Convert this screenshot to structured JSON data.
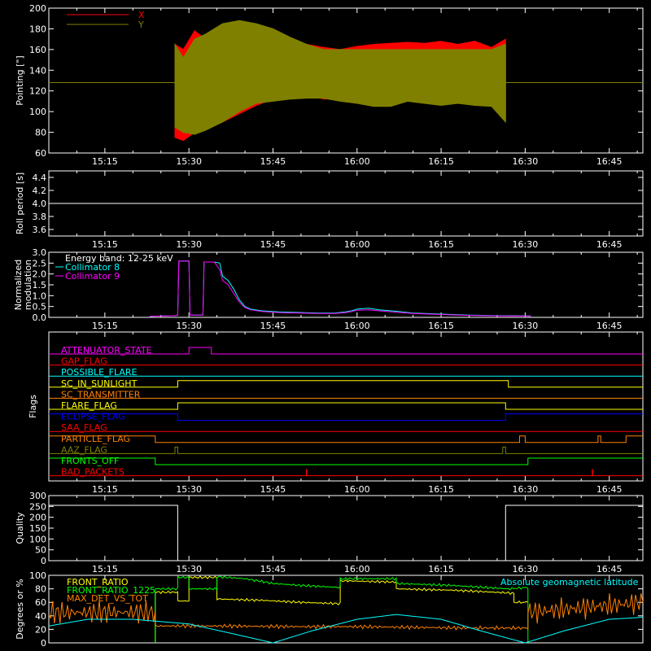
{
  "time_ticks": [
    "15:15",
    "15:30",
    "15:45",
    "16:00",
    "16:15",
    "16:30",
    "16:45"
  ],
  "time_range_min": [
    905,
    1011
  ],
  "tick_minutes": [
    915,
    930,
    945,
    960,
    975,
    990,
    1005
  ],
  "colors": {
    "red": "#ff0000",
    "olive": "#808000",
    "white": "#ffffff",
    "cyan": "#00ffff",
    "magenta": "#ff00ff",
    "yellow": "#ffff00",
    "orange": "#ff8000",
    "green": "#00ff00",
    "blue": "#0000ff"
  },
  "chart_data": [
    {
      "type": "area",
      "panel": "pointing",
      "ylabel": "Pointing [\"]",
      "ylim": [
        60,
        200
      ],
      "yticks": [
        60,
        80,
        100,
        120,
        140,
        160,
        180,
        200
      ],
      "legend": [
        "X",
        "Y"
      ],
      "baseline": 128,
      "series": [
        {
          "name": "X",
          "color": "#ff0000",
          "x": [
            927.5,
            929,
            931,
            933,
            936,
            939,
            942,
            945,
            948,
            951,
            954,
            957,
            960,
            963,
            966,
            969,
            972,
            975,
            978,
            981,
            984,
            986.5
          ],
          "max": [
            165,
            160,
            178,
            170,
            182,
            176,
            178,
            175,
            170,
            165,
            162,
            160,
            163,
            165,
            166,
            167,
            166,
            168,
            165,
            168,
            162,
            170
          ],
          "min": [
            75,
            72,
            80,
            84,
            90,
            98,
            106,
            112,
            115,
            118,
            112,
            113,
            115,
            112,
            115,
            112,
            115,
            110,
            115,
            110,
            112,
            95
          ]
        },
        {
          "name": "Y",
          "color": "#808000",
          "x": [
            927.5,
            929,
            931,
            933,
            936,
            939,
            942,
            945,
            948,
            951,
            954,
            957,
            960,
            963,
            966,
            969,
            972,
            975,
            978,
            981,
            984,
            986.5
          ],
          "max": [
            165,
            152,
            170,
            175,
            185,
            188,
            185,
            180,
            172,
            165,
            160,
            160,
            160,
            160,
            160,
            160,
            160,
            160,
            160,
            160,
            160,
            165
          ],
          "min": [
            85,
            80,
            78,
            82,
            90,
            100,
            108,
            110,
            112,
            113,
            113,
            110,
            108,
            105,
            105,
            110,
            108,
            106,
            108,
            106,
            105,
            90
          ]
        }
      ]
    },
    {
      "type": "line",
      "panel": "roll",
      "ylabel": "Roll period [s]",
      "ylim": [
        3.5,
        4.5
      ],
      "yticks": [
        3.6,
        3.8,
        4.0,
        4.2,
        4.4
      ],
      "series": [
        {
          "name": "",
          "color": "#ffffff",
          "x": [
            905,
            1011
          ],
          "y": [
            4.0,
            4.0
          ]
        }
      ]
    },
    {
      "type": "line",
      "panel": "modulation",
      "ylabel": "Normalized modulation",
      "ylim": [
        0,
        3.0
      ],
      "yticks": [
        0.0,
        0.5,
        1.0,
        1.5,
        2.0,
        2.5,
        3.0
      ],
      "annotation": "Energy band: 12-25 keV",
      "legend": [
        "Collimator 8",
        "Collimator 9"
      ],
      "series": [
        {
          "name": "Collimator 8",
          "color": "#00ffff",
          "x": [
            923,
            927.5,
            928,
            928.2,
            930,
            930.2,
            932.5,
            932.7,
            934.5,
            935.5,
            936,
            937,
            938,
            939,
            940,
            941,
            943,
            946,
            950,
            953,
            956,
            958,
            959,
            960,
            962,
            964,
            967,
            970,
            975,
            980,
            985,
            990,
            991
          ],
          "y": [
            0.05,
            0.08,
            0.1,
            2.6,
            2.6,
            0.1,
            0.1,
            2.55,
            2.55,
            2.5,
            1.9,
            1.7,
            1.3,
            0.8,
            0.5,
            0.38,
            0.3,
            0.25,
            0.22,
            0.2,
            0.2,
            0.25,
            0.3,
            0.38,
            0.42,
            0.35,
            0.28,
            0.2,
            0.15,
            0.1,
            0.08,
            0.07,
            0.06
          ]
        },
        {
          "name": "Collimator 9",
          "color": "#ff00ff",
          "x": [
            923,
            927.5,
            928,
            928.2,
            930,
            930.2,
            932.5,
            932.7,
            934.5,
            935.5,
            936,
            937,
            938,
            939,
            940,
            941,
            943,
            946,
            950,
            953,
            956,
            958,
            959,
            960,
            962,
            964,
            967,
            970,
            975,
            980,
            985,
            990,
            991
          ],
          "y": [
            0.05,
            0.08,
            0.1,
            2.6,
            2.6,
            0.1,
            0.1,
            2.55,
            2.55,
            2.2,
            1.7,
            1.5,
            1.1,
            0.7,
            0.45,
            0.35,
            0.27,
            0.22,
            0.2,
            0.18,
            0.18,
            0.22,
            0.27,
            0.33,
            0.35,
            0.3,
            0.24,
            0.18,
            0.13,
            0.09,
            0.07,
            0.06,
            0.05
          ]
        }
      ]
    },
    {
      "type": "line",
      "panel": "flags",
      "ylabel": "Flags",
      "series": [
        {
          "name": "ATTENUATOR_STATE",
          "color": "#ff00ff",
          "x": [
            905,
            930,
            930,
            934,
            934,
            1011
          ],
          "y": [
            0,
            0,
            1,
            1,
            0,
            0
          ]
        },
        {
          "name": "GAP_FLAG",
          "color": "#ff0000",
          "x": [
            905,
            1011
          ],
          "y": [
            0,
            0
          ]
        },
        {
          "name": "POSSIBLE_FLARE",
          "color": "#00ffff",
          "x": [
            905,
            1011
          ],
          "y": [
            0,
            0
          ]
        },
        {
          "name": "SC_IN_SUNLIGHT",
          "color": "#ffff00",
          "x": [
            905,
            928,
            928,
            987,
            987,
            1011
          ],
          "y": [
            0,
            0,
            1,
            1,
            0,
            0
          ]
        },
        {
          "name": "SC_TRANSMITTER",
          "color": "#ff8000",
          "x": [
            905,
            1011
          ],
          "y": [
            0,
            0
          ]
        },
        {
          "name": "FLARE_FLAG",
          "color": "#ffff00",
          "x": [
            905,
            928,
            928,
            986.5,
            986.5,
            1011
          ],
          "y": [
            0,
            0,
            1,
            1,
            0,
            0
          ]
        },
        {
          "name": "ECLIPSE_FLAG",
          "color": "#0000ff",
          "x": [
            905,
            928,
            928,
            986.5,
            986.5,
            1011
          ],
          "y": [
            1,
            1,
            0,
            0,
            1,
            1
          ]
        },
        {
          "name": "SAA_FLAG",
          "color": "#ff0000",
          "x": [
            905,
            1011
          ],
          "y": [
            0,
            0
          ]
        },
        {
          "name": "PARTICLE_FLAG",
          "color": "#ff8000",
          "x": [
            905,
            924,
            924,
            989,
            989,
            990,
            990,
            1003,
            1003,
            1003.5,
            1003.5,
            1008,
            1008,
            1011
          ],
          "y": [
            1,
            1,
            0,
            0,
            1,
            1,
            0,
            0,
            1,
            1,
            0,
            0,
            1,
            1
          ]
        },
        {
          "name": "AAZ_FLAG",
          "color": "#808000",
          "x": [
            905,
            927.5,
            927.5,
            928,
            928,
            986,
            986,
            986.5,
            986.5,
            1011
          ],
          "y": [
            0,
            0,
            1,
            1,
            0,
            0,
            1,
            1,
            0,
            0
          ]
        },
        {
          "name": "FRONTS_OFF",
          "color": "#00ff00",
          "x": [
            905,
            924,
            924,
            990.5,
            990.5,
            1011
          ],
          "y": [
            1,
            1,
            0,
            0,
            1,
            1
          ]
        },
        {
          "name": "BAD_PACKETS",
          "color": "#ff0000",
          "x": [
            905,
            1011
          ],
          "y": [
            0,
            0
          ],
          "spikes": [
            951,
            1002
          ]
        }
      ]
    },
    {
      "type": "line",
      "panel": "quality",
      "ylabel": "Quality",
      "ylim": [
        0,
        300
      ],
      "yticks": [
        0,
        50,
        100,
        150,
        200,
        250,
        300
      ],
      "series": [
        {
          "name": "",
          "color": "#ffffff",
          "x": [
            905,
            928,
            928,
            986.5,
            986.5,
            1011
          ],
          "y": [
            255,
            255,
            0,
            0,
            255,
            255
          ]
        }
      ]
    },
    {
      "type": "line",
      "panel": "ratios",
      "ylabel": "Degrees or %",
      "ylim": [
        0,
        100
      ],
      "yticks": [
        0,
        20,
        40,
        60,
        80,
        100
      ],
      "annotation": "Absolute geomagnetic latitude",
      "legend": [
        "FRONT_RATIO",
        "FRONT_RATIO_1225",
        "MAX_DET_VS_TOT"
      ],
      "series": [
        {
          "name": "FRONT_RATIO",
          "color": "#ffff00",
          "x": [
            924,
            924,
            928,
            928,
            930,
            930,
            935,
            935,
            943,
            950,
            957,
            957,
            967,
            967,
            977,
            987,
            988,
            988,
            990.5
          ],
          "y": [
            0,
            75,
            75,
            62,
            62,
            97,
            97,
            65,
            63,
            60,
            58,
            92,
            90,
            80,
            78,
            74,
            73,
            60,
            60
          ]
        },
        {
          "name": "FRONT_RATIO_1225",
          "color": "#00ff00",
          "x": [
            924,
            924,
            928,
            928,
            930,
            930,
            935,
            935,
            940,
            945,
            950,
            957,
            957,
            967,
            967,
            977,
            987,
            990.5,
            990.5
          ],
          "y": [
            0,
            80,
            80,
            97,
            97,
            80,
            80,
            98,
            95,
            88,
            85,
            82,
            95,
            95,
            88,
            85,
            80,
            82,
            0
          ]
        },
        {
          "name": "MAX_DET_VS_TOT",
          "color": "#ff8000",
          "x": [
            905,
            924,
            924,
            935,
            950,
            960,
            970,
            980,
            990.5,
            990.5,
            1011
          ],
          "y": [
            45,
            45,
            25,
            25,
            24,
            24,
            23,
            22,
            22,
            45,
            60
          ]
        },
        {
          "name": "Absolute geomagnetic latitude",
          "color": "#00ffff",
          "x": [
            905,
            912,
            920,
            930,
            937,
            945,
            952,
            960,
            967,
            975,
            982,
            990,
            997,
            1005,
            1011
          ],
          "y": [
            25,
            35,
            35,
            28,
            15,
            0,
            18,
            35,
            42,
            35,
            18,
            0,
            18,
            35,
            38
          ]
        }
      ]
    }
  ]
}
